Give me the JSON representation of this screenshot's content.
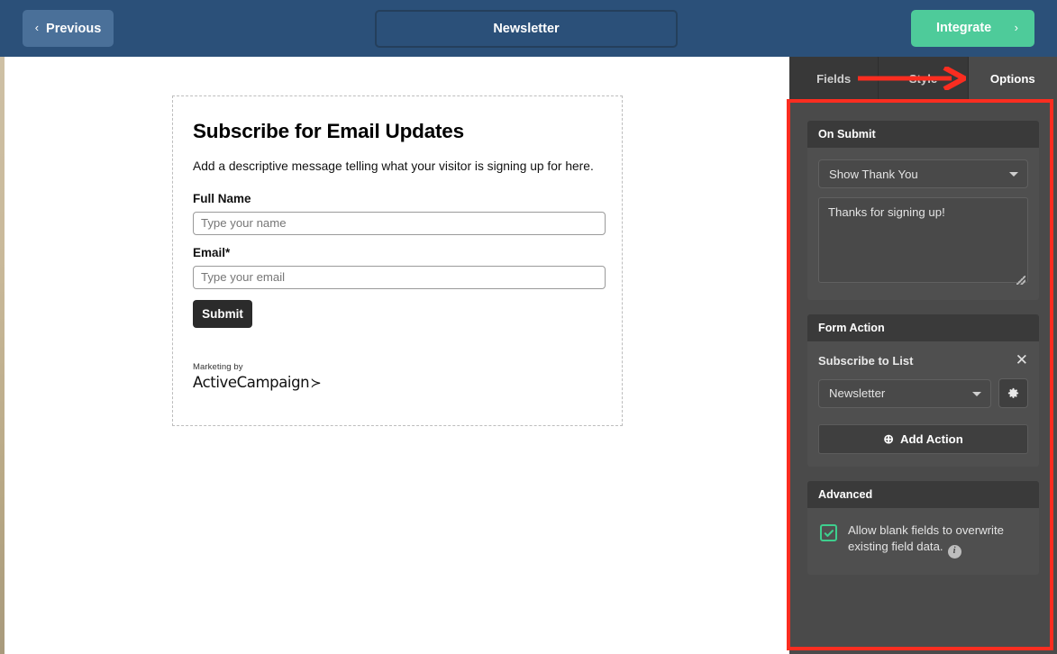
{
  "topbar": {
    "previous_label": "Previous",
    "previous_chevron": "‹",
    "form_title": "Newsletter",
    "integrate_label": "Integrate",
    "integrate_chevron": "›",
    "bg_color": "#2b5079",
    "integrate_color": "#4ecb9a"
  },
  "form_preview": {
    "heading": "Subscribe for Email Updates",
    "description": "Add a descriptive message telling what your visitor is signing up for here.",
    "fields": [
      {
        "label": "Full Name",
        "placeholder": "Type your name",
        "value": ""
      },
      {
        "label": "Email*",
        "placeholder": "Type your email",
        "value": ""
      }
    ],
    "submit_label": "Submit",
    "branding_top": "Marketing by",
    "branding_name": "ActiveCampaign",
    "branding_arrow": "≻"
  },
  "right_panel": {
    "tabs": [
      {
        "label": "Fields",
        "active": false
      },
      {
        "label": "Style",
        "active": false
      },
      {
        "label": "Options",
        "active": true
      }
    ],
    "on_submit": {
      "title": "On Submit",
      "select_value": "Show Thank You",
      "message_value": "Thanks for signing up!"
    },
    "form_action": {
      "title": "Form Action",
      "action_title": "Subscribe to List",
      "close_glyph": "✕",
      "list_value": "Newsletter",
      "gear_icon": "gear-icon",
      "add_action_label": "Add Action",
      "add_action_plus": "⊕"
    },
    "advanced": {
      "title": "Advanced",
      "checkbox_checked": true,
      "checkbox_color": "#3ecf8e",
      "label": "Allow blank fields to overwrite existing field data.",
      "info_glyph": "i"
    }
  },
  "annotations": {
    "color": "#fb2d20",
    "arrow_target": "Options",
    "box_target": "options-panel"
  }
}
